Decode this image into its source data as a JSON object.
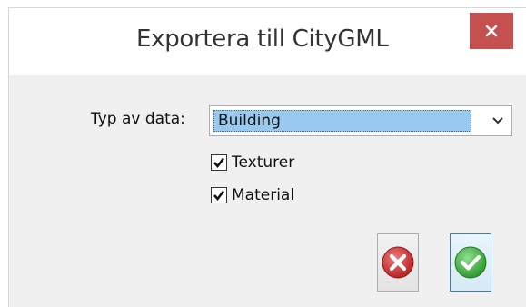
{
  "window": {
    "title": "Exportera till CityGML",
    "close_label": "✕"
  },
  "form": {
    "type_label": "Typ av data:",
    "type_value": "Building",
    "checkboxes": [
      {
        "label": "Texturer",
        "checked": true
      },
      {
        "label": "Material",
        "checked": true
      }
    ]
  },
  "buttons": {
    "cancel_icon": "cancel-x-icon",
    "ok_icon": "ok-check-icon"
  },
  "colors": {
    "close_red": "#c4514f",
    "selection_blue": "#99c9ef",
    "cancel_red": "#d13b3b",
    "ok_green": "#4cb84c"
  }
}
